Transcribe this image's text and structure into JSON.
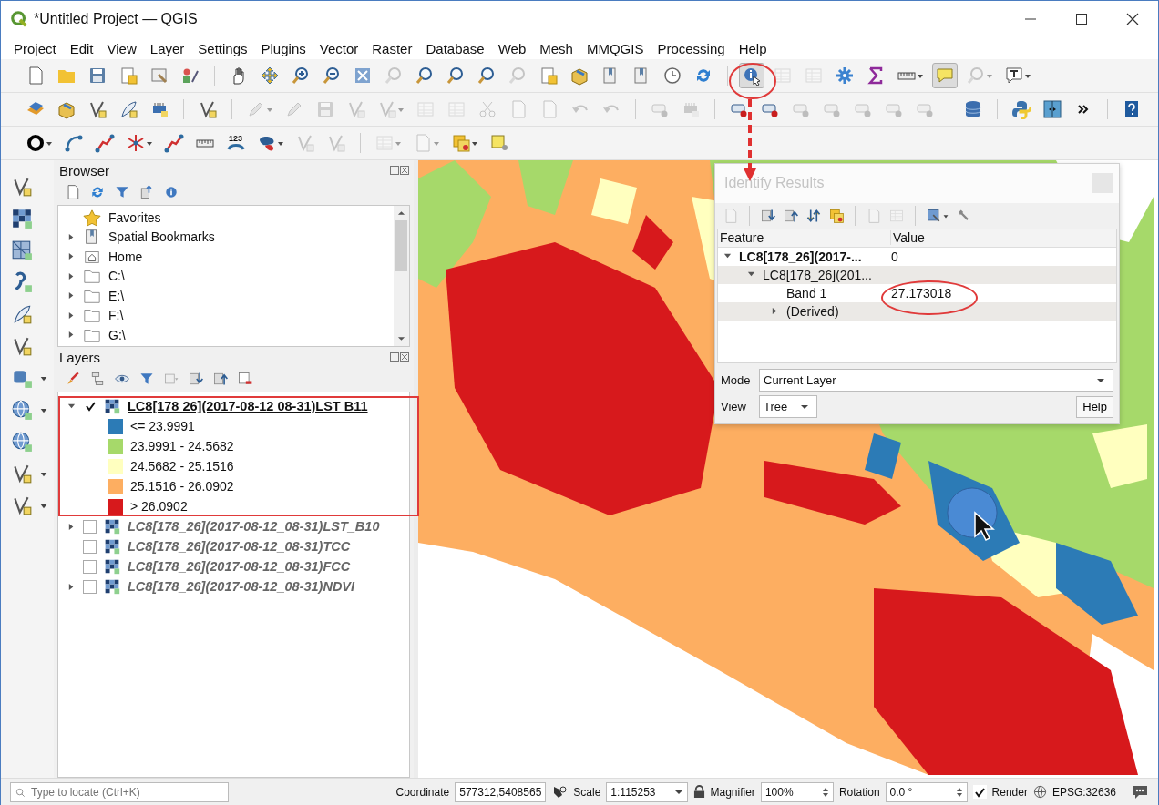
{
  "window": {
    "title": "*Untitled Project — QGIS"
  },
  "menu": [
    "Project",
    "Edit",
    "View",
    "Layer",
    "Settings",
    "Plugins",
    "Vector",
    "Raster",
    "Database",
    "Web",
    "Mesh",
    "MMQGIS",
    "Processing",
    "Help"
  ],
  "toolbars": [
    {
      "buttons": [
        {
          "kind": "page",
          "disabled": false
        },
        {
          "kind": "folder",
          "disabled": false
        },
        {
          "kind": "floppy",
          "disabled": false
        },
        {
          "kind": "pagestar",
          "disabled": false
        },
        {
          "kind": "printer",
          "disabled": false
        },
        {
          "kind": "palette",
          "disabled": false
        },
        {
          "kind": "sep"
        },
        {
          "kind": "hand",
          "disabled": false
        },
        {
          "kind": "arrows",
          "disabled": false
        },
        {
          "kind": "zoomin",
          "disabled": false
        },
        {
          "kind": "zoomout",
          "disabled": false
        },
        {
          "kind": "zoomfull",
          "disabled": false
        },
        {
          "kind": "lens",
          "disabled": true
        },
        {
          "kind": "lens",
          "disabled": false
        },
        {
          "kind": "lens",
          "disabled": false
        },
        {
          "kind": "lens",
          "disabled": false
        },
        {
          "kind": "lens",
          "disabled": true
        },
        {
          "kind": "pagestar",
          "disabled": false
        },
        {
          "kind": "box3d",
          "disabled": false
        },
        {
          "kind": "bookmark",
          "disabled": false
        },
        {
          "kind": "bookmark",
          "disabled": false
        },
        {
          "kind": "clock",
          "disabled": false
        },
        {
          "kind": "refresh",
          "disabled": false
        },
        {
          "kind": "sep"
        },
        {
          "kind": "identify",
          "disabled": false,
          "selected": true
        },
        {
          "kind": "table",
          "disabled": true
        },
        {
          "kind": "table",
          "disabled": true
        },
        {
          "kind": "gear",
          "disabled": false
        },
        {
          "kind": "sigma",
          "disabled": false
        },
        {
          "kind": "ruler",
          "disabled": false,
          "menu": true
        },
        {
          "kind": "tip",
          "disabled": false,
          "selected": true
        },
        {
          "kind": "lens",
          "disabled": true,
          "menu": true
        },
        {
          "kind": "textbox",
          "disabled": false,
          "menu": true
        }
      ]
    },
    {
      "buttons": [
        {
          "kind": "layers",
          "disabled": false
        },
        {
          "kind": "box3d",
          "disabled": false
        },
        {
          "kind": "vertex",
          "disabled": false
        },
        {
          "kind": "feather",
          "disabled": false
        },
        {
          "kind": "chip",
          "disabled": false
        },
        {
          "kind": "sep"
        },
        {
          "kind": "vertex",
          "disabled": false
        },
        {
          "kind": "sep"
        },
        {
          "kind": "pencil",
          "disabled": true,
          "menu": true
        },
        {
          "kind": "pencil",
          "disabled": true
        },
        {
          "kind": "floppy",
          "disabled": true
        },
        {
          "kind": "vertex",
          "disabled": true
        },
        {
          "kind": "vertex",
          "disabled": true,
          "menu": true
        },
        {
          "kind": "table",
          "disabled": true
        },
        {
          "kind": "table",
          "disabled": true
        },
        {
          "kind": "scissors",
          "disabled": true
        },
        {
          "kind": "page",
          "disabled": true
        },
        {
          "kind": "page",
          "disabled": true
        },
        {
          "kind": "undo",
          "disabled": true
        },
        {
          "kind": "undo",
          "disabled": true
        },
        {
          "kind": "sep"
        },
        {
          "kind": "label",
          "disabled": true
        },
        {
          "kind": "chip",
          "disabled": true
        },
        {
          "kind": "sep"
        },
        {
          "kind": "label",
          "disabled": false
        },
        {
          "kind": "label",
          "disabled": false
        },
        {
          "kind": "label",
          "disabled": true
        },
        {
          "kind": "label",
          "disabled": true
        },
        {
          "kind": "label",
          "disabled": true
        },
        {
          "kind": "label",
          "disabled": true
        },
        {
          "kind": "label",
          "disabled": true
        },
        {
          "kind": "sep"
        },
        {
          "kind": "database",
          "disabled": false
        },
        {
          "kind": "sep"
        },
        {
          "kind": "python",
          "disabled": false
        },
        {
          "kind": "plugin",
          "disabled": false
        },
        {
          "kind": "more",
          "disabled": false
        },
        {
          "kind": "sep"
        },
        {
          "kind": "help",
          "disabled": false
        }
      ]
    },
    {
      "buttons": [
        {
          "kind": "ring",
          "disabled": false,
          "menu": true
        },
        {
          "kind": "curve",
          "disabled": false
        },
        {
          "kind": "polyline",
          "disabled": false
        },
        {
          "kind": "star",
          "disabled": false,
          "menu": true
        },
        {
          "kind": "polyline",
          "disabled": false
        },
        {
          "kind": "ruler",
          "disabled": false
        },
        {
          "kind": "numbered",
          "disabled": false,
          "label": "123"
        },
        {
          "kind": "blob",
          "disabled": false,
          "menu": true
        },
        {
          "kind": "vertex",
          "disabled": true
        },
        {
          "kind": "vertex",
          "disabled": true
        },
        {
          "kind": "sep"
        },
        {
          "kind": "table",
          "disabled": true,
          "menu": true
        },
        {
          "kind": "page",
          "disabled": true,
          "menu": true
        },
        {
          "kind": "squares",
          "disabled": false,
          "menu": true
        },
        {
          "kind": "pin",
          "disabled": false
        }
      ]
    }
  ],
  "left_toolbar": [
    {
      "kind": "vertex"
    },
    {
      "kind": "raster"
    },
    {
      "kind": "mesh"
    },
    {
      "kind": "text"
    },
    {
      "kind": "feather"
    },
    {
      "kind": "vertex"
    },
    {
      "kind": "plug",
      "menu": true
    },
    {
      "kind": "globe",
      "menu": true
    },
    {
      "kind": "globe"
    },
    {
      "kind": "vertex",
      "menu": true
    },
    {
      "kind": "vertex",
      "menu": true
    }
  ],
  "browser": {
    "title": "Browser",
    "tools": [
      {
        "kind": "page"
      },
      {
        "kind": "refresh"
      },
      {
        "kind": "filter"
      },
      {
        "kind": "collapse"
      },
      {
        "kind": "info"
      }
    ],
    "items": [
      {
        "label": "Favorites",
        "kind": "star",
        "expandable": false
      },
      {
        "label": "Spatial Bookmarks",
        "kind": "bookmark",
        "expandable": true,
        "expanded": false
      },
      {
        "label": "Home",
        "kind": "home",
        "expandable": true,
        "expanded": false
      },
      {
        "label": "C:\\",
        "kind": "folder",
        "expandable": true,
        "expanded": false
      },
      {
        "label": "E:\\",
        "kind": "folder",
        "expandable": true,
        "expanded": false
      },
      {
        "label": "F:\\",
        "kind": "folder",
        "expandable": true,
        "expanded": false
      },
      {
        "label": "G:\\",
        "kind": "folder",
        "expandable": true,
        "expanded": false
      }
    ]
  },
  "layers": {
    "title": "Layers",
    "tools": [
      {
        "kind": "brush"
      },
      {
        "kind": "tree"
      },
      {
        "kind": "eye"
      },
      {
        "kind": "filter"
      },
      {
        "kind": "group"
      },
      {
        "kind": "down"
      },
      {
        "kind": "up"
      },
      {
        "kind": "remove"
      }
    ],
    "items": [
      {
        "name": "LC8[178 26](2017-08-12 08-31)LST B11",
        "checked": true,
        "selected": true,
        "expandable": true,
        "expanded": true,
        "legend": [
          {
            "label": "<= 23.9991",
            "color": "#2c7bb6"
          },
          {
            "label": "23.9991 - 24.5682",
            "color": "#a6d96a"
          },
          {
            "label": "24.5682 - 25.1516",
            "color": "#ffffbf"
          },
          {
            "label": "25.1516 - 26.0902",
            "color": "#fdae61"
          },
          {
            "label": "> 26.0902",
            "color": "#d7191c"
          }
        ]
      },
      {
        "name": "LC8[178_26](2017-08-12_08-31)LST_B10",
        "checked": false,
        "selected": false,
        "expandable": true,
        "expanded": false
      },
      {
        "name": "LC8[178_26](2017-08-12_08-31)TCC",
        "checked": false,
        "selected": false,
        "expandable": false
      },
      {
        "name": "LC8[178_26](2017-08-12_08-31)FCC",
        "checked": false,
        "selected": false,
        "expandable": false
      },
      {
        "name": "LC8[178_26](2017-08-12_08-31)NDVI",
        "checked": false,
        "selected": false,
        "expandable": true,
        "expanded": false
      }
    ]
  },
  "identify": {
    "title": "Identify Results",
    "tools": [
      {
        "kind": "page",
        "disabled": true
      },
      {
        "kind": "down",
        "disabled": false
      },
      {
        "kind": "up",
        "disabled": false
      },
      {
        "kind": "updown",
        "disabled": false
      },
      {
        "kind": "squares",
        "disabled": false
      },
      {
        "kind": "page",
        "disabled": true
      },
      {
        "kind": "table",
        "disabled": true
      },
      {
        "kind": "export",
        "disabled": false,
        "menu": true
      },
      {
        "kind": "wrench",
        "disabled": false
      }
    ],
    "columns": [
      "Feature",
      "Value"
    ],
    "rows": [
      {
        "feature": "LC8[178_26](2017-...",
        "value": "0",
        "expanded": true,
        "children": [
          {
            "feature": "LC8[178_26](201...",
            "expanded": true,
            "children": [
              {
                "feature": "Band 1",
                "value": "27.173018"
              },
              {
                "feature": "(Derived)",
                "expanded": false
              }
            ]
          }
        ]
      }
    ],
    "mode_label": "Mode",
    "mode": "Current Layer",
    "view_label": "View",
    "view": "Tree",
    "help": "Help"
  },
  "status_bar": {
    "locator_placeholder": "Type to locate (Ctrl+K)",
    "coordinate_label": "Coordinate",
    "coordinate": "577312,5408565",
    "scale_label": "Scale",
    "scale": "1:115253",
    "magnifier_label": "Magnifier",
    "magnifier": "100%",
    "rotation_label": "Rotation",
    "rotation": "0.0 °",
    "render_label": "Render",
    "render_checked": true,
    "crs": "EPSG:32636"
  }
}
